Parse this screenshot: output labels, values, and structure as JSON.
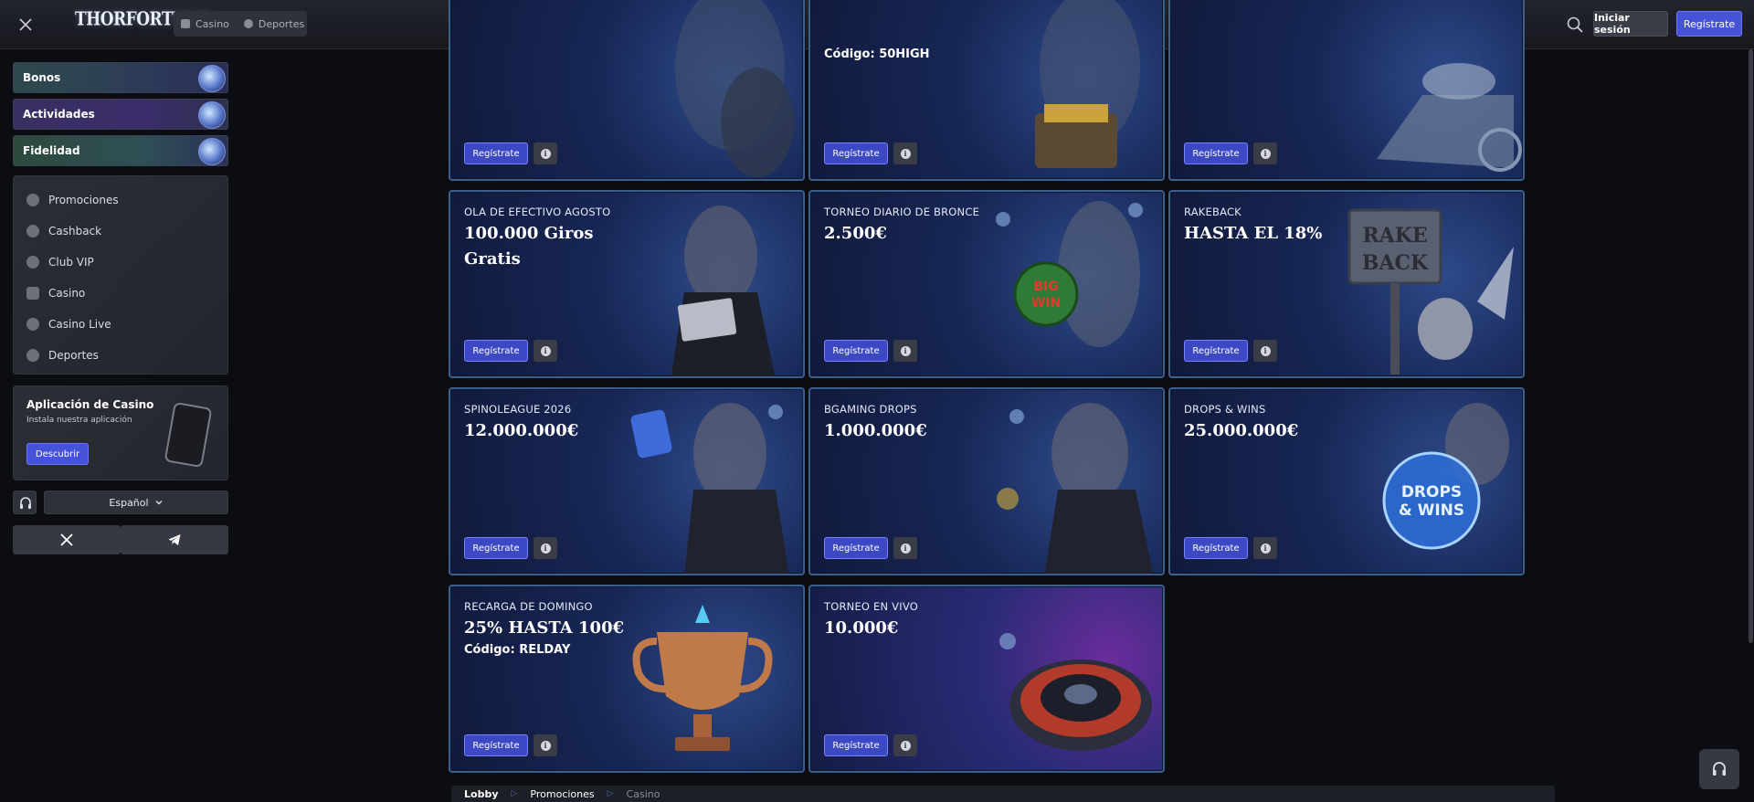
{
  "header": {
    "logo": "THORFORTUNE",
    "tabs": [
      {
        "label": "Casino",
        "icon": "casino-icon"
      },
      {
        "label": "Deportes",
        "icon": "sports-icon"
      }
    ],
    "login_label": "Iniciar sesión",
    "register_label": "Regístrate"
  },
  "sidebar": {
    "pills": [
      {
        "label": "Bonos"
      },
      {
        "label": "Actividades"
      },
      {
        "label": "Fidelidad"
      }
    ],
    "menu": [
      {
        "label": "Promociones",
        "icon": "promotions-icon"
      },
      {
        "label": "Cashback",
        "icon": "cashback-icon"
      },
      {
        "label": "Club VIP",
        "icon": "crown-icon"
      },
      {
        "label": "Casino",
        "icon": "casino-icon"
      },
      {
        "label": "Casino Live",
        "icon": "casino-live-icon"
      },
      {
        "label": "Deportes",
        "icon": "sports-icon"
      }
    ],
    "app": {
      "title": "Aplicación de Casino",
      "subtitle": "Instala nuestra aplicación",
      "button": "Descubrir"
    },
    "language": "Español"
  },
  "promos": {
    "register_label": "Regístrate",
    "info_glyph": "i",
    "cards": [
      {
        "label": "",
        "title": "",
        "code": ""
      },
      {
        "label": "",
        "title": "",
        "code": "Código: 50HIGH"
      },
      {
        "label": "",
        "title": "",
        "code": ""
      },
      {
        "label": "OLA DE EFECTIVO AGOSTO",
        "title": "100.000 Giros Gratis",
        "code": ""
      },
      {
        "label": "TORNEO DIARIO DE BRONCE",
        "title": "2.500€",
        "code": ""
      },
      {
        "label": "RAKEBACK",
        "title": "HASTA EL 18%",
        "code": ""
      },
      {
        "label": "SPINOLEAGUE 2026",
        "title": "12.000.000€",
        "code": ""
      },
      {
        "label": "BGAMING DROPS",
        "title": "1.000.000€",
        "code": ""
      },
      {
        "label": "DROPS & WINS",
        "title": "25.000.000€",
        "code": ""
      },
      {
        "label": "RECARGA DE DOMINGO",
        "title": "25% HASTA 100€",
        "code": "Código: RELDAY"
      },
      {
        "label": "TORNEO EN VIVO",
        "title": "10.000€",
        "code": ""
      }
    ],
    "art_text": {
      "big_win": "BIG WIN",
      "rake_back": "RAKE BACK",
      "drops_wins": "DROPS & WINS"
    }
  },
  "breadcrumb": [
    "Lobby",
    "Promociones",
    "Casino"
  ],
  "colors": {
    "accent": "#4652d8",
    "card_border": "#3d5f8b",
    "background": "#0c0d12"
  }
}
